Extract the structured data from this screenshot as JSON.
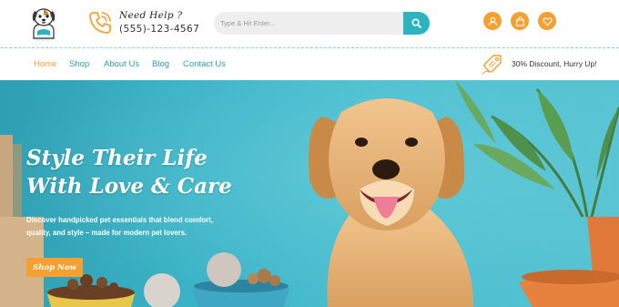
{
  "header": {
    "help_title": "Need Help ?",
    "help_phone": "(555)-123-4567",
    "search": {
      "placeholder": "Type & Hit Enter..."
    },
    "icons": [
      "user-icon",
      "shopping-bag-icon",
      "heart-icon"
    ]
  },
  "nav": {
    "items": [
      {
        "label": "Home",
        "active": true
      },
      {
        "label": "Shop"
      },
      {
        "label": "About Us"
      },
      {
        "label": "Blog"
      },
      {
        "label": "Contact Us"
      }
    ],
    "promo": "30% Discount, Hurry Up!"
  },
  "hero": {
    "title": "Style Their Life With Love & Care",
    "description": "Discover handpicked pet essentials that blend comfort, quality, and style – made for modern pet lovers.",
    "cta": "Shop Now"
  },
  "colors": {
    "accent_orange": "#f5a031",
    "teal": "#2bb3c0",
    "nav_text": "#2b9fb0"
  }
}
